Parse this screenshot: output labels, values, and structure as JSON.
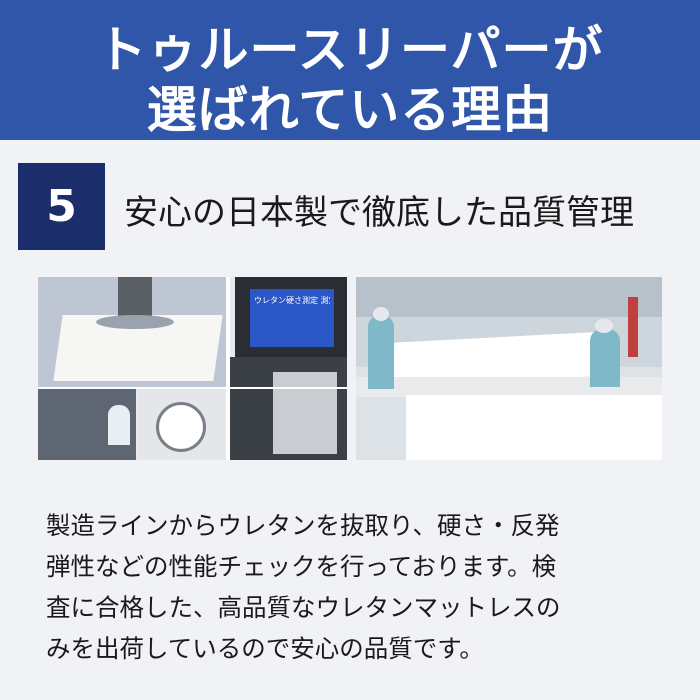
{
  "header": {
    "title_line1": "トゥルースリーパーが",
    "title_line2": "選ばれている理由"
  },
  "section": {
    "number": "5",
    "title": "安心の日本製で徹底した品質管理"
  },
  "photos": {
    "left_screen_text": "ウレタン硬さ測定 測定結果"
  },
  "description": {
    "lines": [
      "製造ラインからウレタンを抜取り、硬さ・反発",
      "弾性などの性能チェックを行っております。検",
      "査に合格した、高品質なウレタンマットレスの",
      "みを出荷しているので安心の品質です。"
    ]
  },
  "colors": {
    "header_bg": "#2f56a8",
    "badge_bg": "#1b2e6b",
    "panel_bg": "#f1f2f6"
  }
}
